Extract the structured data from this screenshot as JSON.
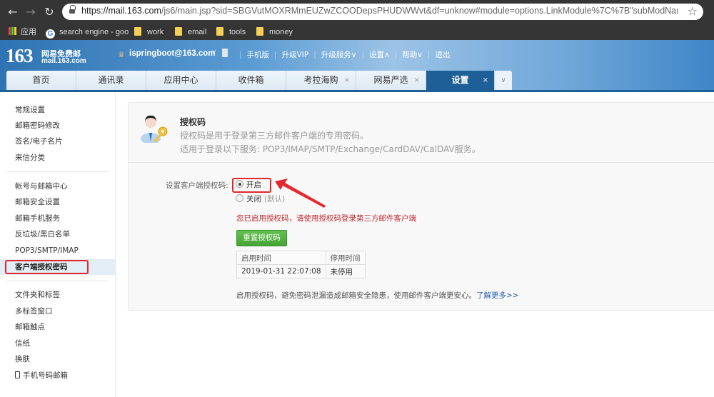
{
  "browser": {
    "url_host": "https://mail.163.com",
    "url_rest": "/js6/main.jsp?sid=SBGVutMOXRMmEUZwZCOODepsPHUDWWvt&df=unknow#module=options.LinkModule%7C%7B\"subModNam...",
    "bookmarks": [
      {
        "label": "应用",
        "icon": "apps-grid-icon"
      },
      {
        "label": "search engine - goo",
        "icon": "google-icon"
      },
      {
        "label": "work",
        "icon": "folder-icon"
      },
      {
        "label": "email",
        "icon": "folder-icon"
      },
      {
        "label": "tools",
        "icon": "folder-icon"
      },
      {
        "label": "money",
        "icon": "folder-icon"
      }
    ]
  },
  "header": {
    "logo_number": "163",
    "logo_cn": "网易免费邮",
    "logo_domain": "mail.163.com",
    "user_email": "ispringboot@163.com",
    "links": [
      "手机版",
      "升级VIP",
      "升级服务∨",
      "设置∧",
      "帮助∨",
      "退出"
    ]
  },
  "tabs": [
    {
      "label": "首页",
      "closable": false,
      "active": false
    },
    {
      "label": "通讯录",
      "closable": false,
      "active": false
    },
    {
      "label": "应用中心",
      "closable": false,
      "active": false
    },
    {
      "label": "收件箱",
      "closable": false,
      "active": false
    },
    {
      "label": "考拉海购",
      "closable": true,
      "active": false
    },
    {
      "label": "网易严选",
      "closable": true,
      "active": false
    },
    {
      "label": "设置",
      "closable": true,
      "active": true
    }
  ],
  "tab_close_glyph": "×",
  "tab_more_glyph": "∨",
  "sidebar": {
    "group1": [
      "常规设置",
      "邮箱密码修改",
      "签名/电子名片",
      "来信分类"
    ],
    "group2": [
      "帐号与邮箱中心",
      "邮箱安全设置",
      "邮箱手机服务",
      "反垃圾/黑白名单",
      "POP3/SMTP/IMAP",
      "客户端授权密码"
    ],
    "group3": [
      "文件夹和标签",
      "多标签窗口",
      "邮箱触点",
      "信纸",
      "换肤",
      "手机号码邮箱"
    ],
    "active_item": "客户端授权密码"
  },
  "main": {
    "title": "授权码",
    "desc1": "授权码是用于登录第三方邮件客户端的专用密码。",
    "desc2": "适用于登录以下服务: POP3/IMAP/SMTP/Exchange/CardDAV/CalDAV服务。",
    "form_label": "设置客户端授权码:",
    "option_on": "开启",
    "option_off": "关闭",
    "option_off_note": "(默认)",
    "selected": "开启",
    "status_msg": "您已启用授权码，请使用授权码登录第三方邮件客户端",
    "reset_button": "重置授权码",
    "table": {
      "headers": [
        "启用时间",
        "停用时间"
      ],
      "rows": [
        [
          "2019-01-31 22:07:08",
          "未停用"
        ]
      ]
    },
    "footer_note": "启用授权码，避免密码泄漏造成邮箱安全隐患，使用邮件客户端更安心。",
    "learn_more": "了解更多>>"
  }
}
